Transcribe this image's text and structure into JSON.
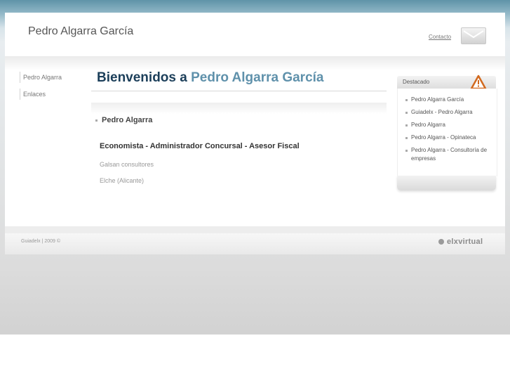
{
  "header": {
    "site_title": "Pedro Algarra García",
    "contact_label": "Contacto"
  },
  "sidebar": {
    "items": [
      {
        "label": "Pedro Algarra"
      },
      {
        "label": "Enlaces"
      }
    ]
  },
  "main": {
    "welcome_prefix": "Bienvenidos a ",
    "welcome_name": "Pedro Algarra García",
    "section_title": "Pedro Algarra",
    "profession": "Economista - Administrador Concursal - Asesor Fiscal",
    "company": "Galsan consultores",
    "location": "Elche (Alicante)"
  },
  "featured": {
    "title": "Destacado",
    "icon": "warning-icon",
    "items": [
      {
        "label": "Pedro Algarra García"
      },
      {
        "label": "Guiadelx - Pedro Algarra"
      },
      {
        "label": "Pedro Algarra"
      },
      {
        "label": "Pedro Algarra - Opinateca"
      },
      {
        "label": "Pedro Algarra - Consultoría de empresas"
      }
    ]
  },
  "footer": {
    "copyright": "Guiadelx | 2009 ©",
    "brand": "elxvirtual"
  },
  "colors": {
    "heading": "#1c3f5a",
    "accent": "#5f91ab",
    "warning": "#d2691e",
    "page_top": "#5f93a8"
  }
}
